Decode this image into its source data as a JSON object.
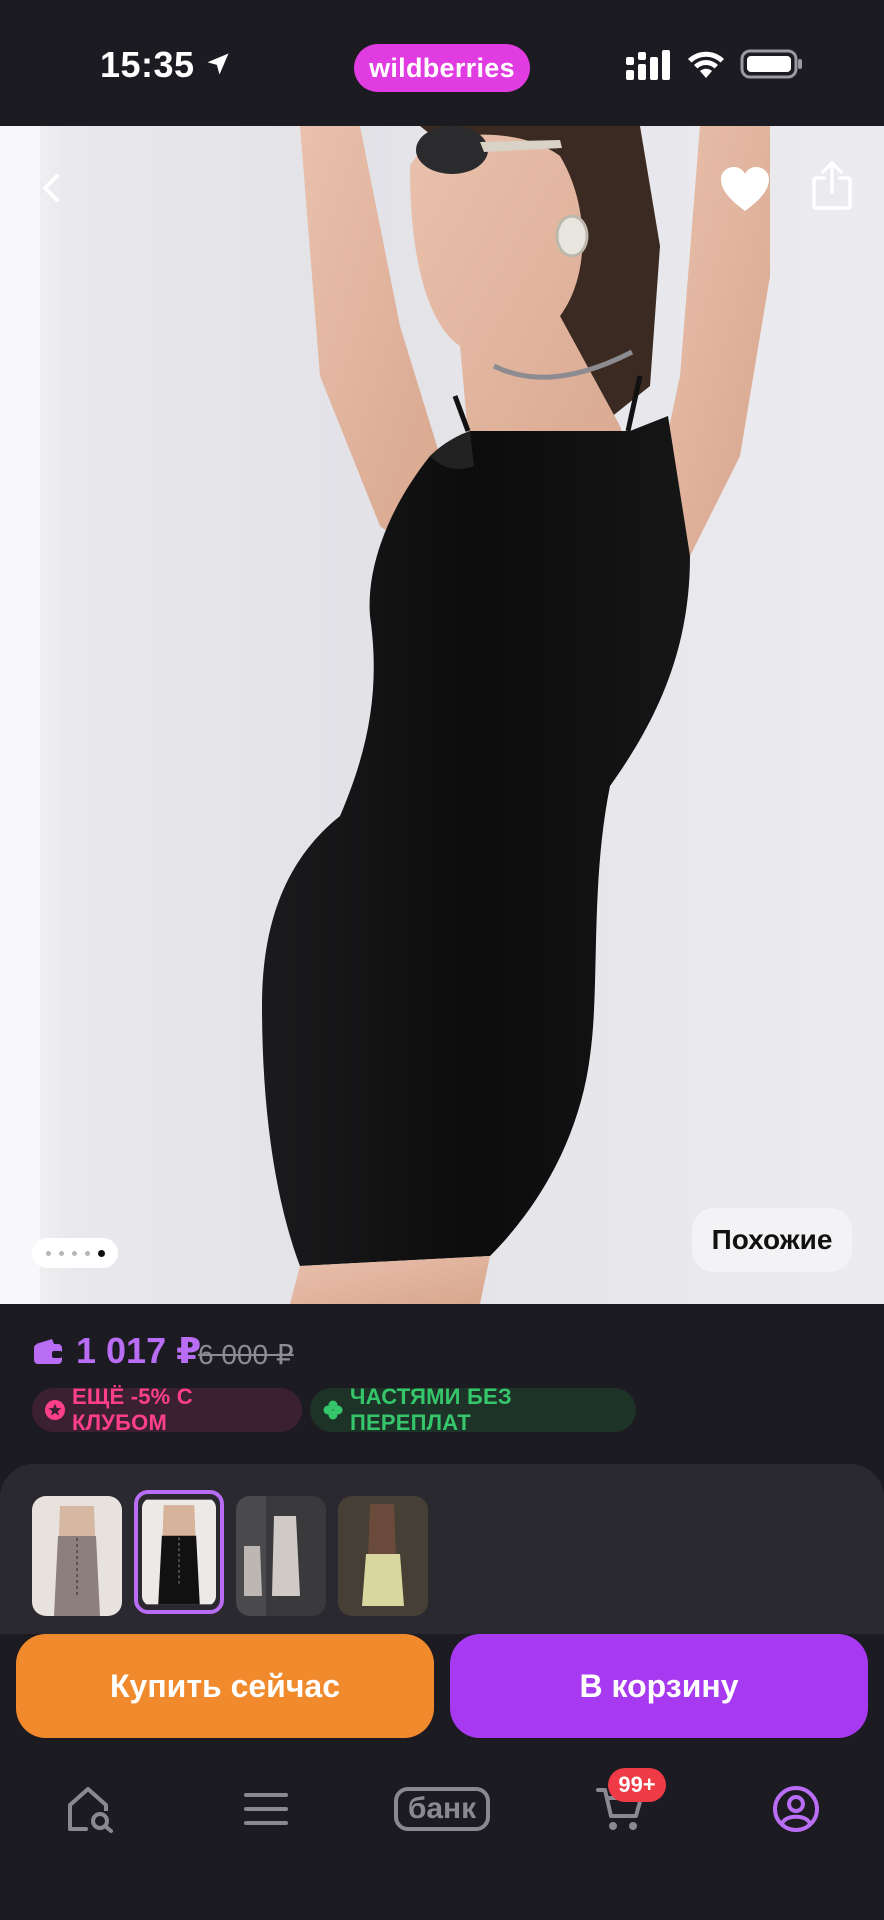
{
  "status_bar": {
    "time": "15:35",
    "brand": "wildberries",
    "brand_color": "#e13be2"
  },
  "hero": {
    "image_indicator": {
      "count": 5,
      "active_index": 4
    },
    "similar_label": "Похожие",
    "icons": [
      "back-icon",
      "heart-icon",
      "share-icon"
    ]
  },
  "price": {
    "current": "1 017 ₽",
    "old": "6 000 ₽",
    "accent": "#b96cf4"
  },
  "badges": {
    "club": "ЕЩЁ -5% С КЛУБОМ",
    "installments": "ЧАСТЯМИ БЕЗ ПЕРЕПЛАТ"
  },
  "thumbnails": {
    "count": 4,
    "selected_index": 1
  },
  "actions": {
    "buy_now": "Купить сейчас",
    "add_to_cart": "В корзину",
    "buy_color": "#f08a2c",
    "cart_color": "#a73af0"
  },
  "tabbar": {
    "bank_label": "банк",
    "cart_badge": "99+",
    "icons": [
      "home-search-icon",
      "catalog-icon",
      "bank-icon",
      "cart-icon",
      "profile-icon"
    ]
  }
}
